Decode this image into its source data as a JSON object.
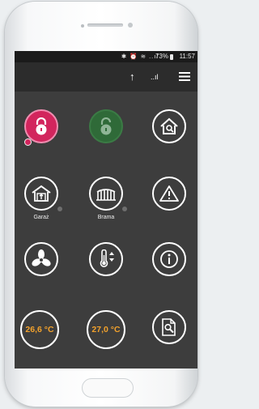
{
  "status_bar": {
    "battery": "73%",
    "time": "11:57",
    "icons": [
      "bluetooth-icon",
      "alarm-icon",
      "wifi-icon",
      "signal-icon"
    ]
  },
  "toolbar": {
    "icons": [
      "upload-arrow-icon",
      "signal-bars-icon",
      "menu-icon"
    ]
  },
  "tiles": [
    {
      "id": "lock-armed",
      "icon": "lock-icon",
      "color": "#d2255d",
      "label": ""
    },
    {
      "id": "lock-disarmed",
      "icon": "lock-open-icon",
      "color": "#2f6a38",
      "label": ""
    },
    {
      "id": "house-search",
      "icon": "house-search-icon",
      "label": ""
    },
    {
      "id": "garage",
      "icon": "garage-icon",
      "label": "Garaż"
    },
    {
      "id": "gate",
      "icon": "gate-icon",
      "label": "Brama"
    },
    {
      "id": "warning",
      "icon": "warning-icon",
      "label": ""
    },
    {
      "id": "fan",
      "icon": "fan-icon",
      "label": ""
    },
    {
      "id": "thermostat",
      "icon": "thermometer-icon",
      "label": ""
    },
    {
      "id": "info",
      "icon": "info-icon",
      "label": ""
    },
    {
      "id": "temp-1",
      "value": "26,6 °C"
    },
    {
      "id": "temp-2",
      "value": "27,0 °C"
    },
    {
      "id": "doc-search",
      "icon": "document-search-icon",
      "label": ""
    }
  ],
  "labels": {
    "garage": "Garaż",
    "gate": "Brama"
  },
  "temps": {
    "t1": "26,6 °C",
    "t2": "27,0 °C"
  }
}
